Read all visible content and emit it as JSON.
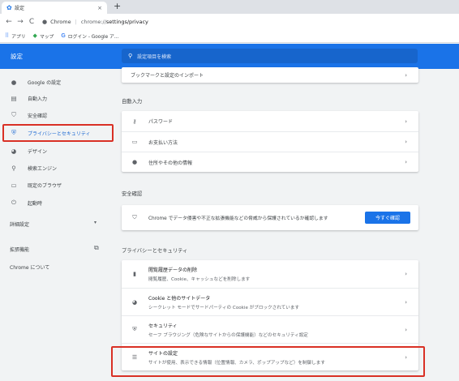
{
  "browser": {
    "tab_title": "設定",
    "tab_close": "×",
    "new_tab": "+",
    "nav_back": "←",
    "nav_forward": "→",
    "nav_reload": "C",
    "site_name": "Chrome",
    "separator": "|",
    "url_prefix": "chrome://",
    "url_path": "settings/privacy",
    "bookmarks": [
      {
        "label": "アプリ",
        "icon": "apps-icon"
      },
      {
        "label": "マップ",
        "icon": "maps-icon"
      },
      {
        "label": "ログイン - Google ア...",
        "icon": "google-icon"
      }
    ]
  },
  "header": {
    "title": "設定",
    "search_placeholder": "設定項目を検索"
  },
  "sidebar": {
    "items": [
      {
        "label": "Google の設定",
        "icon": "person-icon"
      },
      {
        "label": "自動入力",
        "icon": "clipboard-icon"
      },
      {
        "label": "安全確認",
        "icon": "shield-check-icon"
      },
      {
        "label": "プライバシーとセキュリティ",
        "icon": "shield-icon",
        "active": true
      },
      {
        "label": "デザイン",
        "icon": "palette-icon"
      },
      {
        "label": "検索エンジン",
        "icon": "search-icon"
      },
      {
        "label": "既定のブラウザ",
        "icon": "browser-icon"
      },
      {
        "label": "起動時",
        "icon": "power-icon"
      }
    ],
    "advanced": "詳細設定",
    "extensions": "拡張機能",
    "about": "Chrome について"
  },
  "main": {
    "top_row": "ブックマークと設定のインポート",
    "autofill": {
      "heading": "自動入力",
      "rows": [
        {
          "label": "パスワード",
          "icon": "key-icon"
        },
        {
          "label": "お支払い方法",
          "icon": "credit-card-icon"
        },
        {
          "label": "住所やその他の情報",
          "icon": "location-pin-icon"
        }
      ]
    },
    "safety": {
      "heading": "安全確認",
      "text": "Chrome でデータ侵害や不正な拡張機能などの脅威から保護されているか確認します",
      "button": "今すぐ確認"
    },
    "privacy": {
      "heading": "プライバシーとセキュリティ",
      "rows": [
        {
          "title": "閲覧履歴データの削除",
          "subtitle": "閲覧履歴、Cookie、キャッシュなどを削除します",
          "icon": "trash-icon"
        },
        {
          "title": "Cookie と他のサイトデータ",
          "subtitle": "シークレット モードでサードパーティの Cookie がブロックされています",
          "icon": "cookie-icon"
        },
        {
          "title": "セキュリティ",
          "subtitle": "セーフ ブラウジング（危険なサイトからの保護機能）などのセキュリティ設定",
          "icon": "shield-icon"
        },
        {
          "title": "サイトの設定",
          "subtitle": "サイトが使用、表示できる情報（位置情報、カメラ、ポップアップなど）を制御します",
          "icon": "sliders-icon"
        }
      ]
    }
  },
  "colors": {
    "accent": "#1a73e8",
    "highlight_box": "#d93025"
  }
}
